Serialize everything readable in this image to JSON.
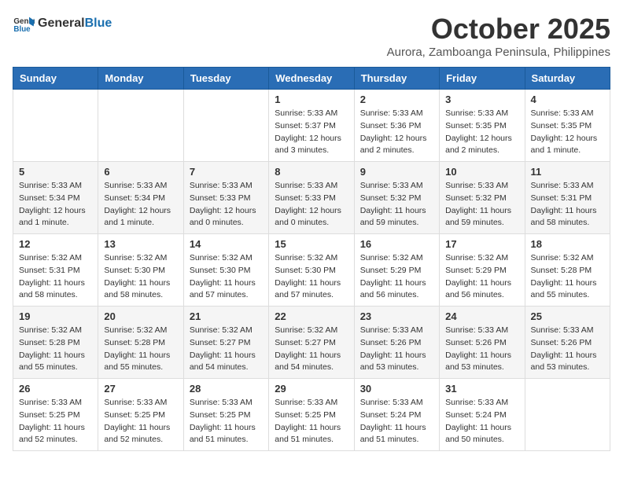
{
  "logo": {
    "general": "General",
    "blue": "Blue"
  },
  "header": {
    "month": "October 2025",
    "location": "Aurora, Zamboanga Peninsula, Philippines"
  },
  "weekdays": [
    "Sunday",
    "Monday",
    "Tuesday",
    "Wednesday",
    "Thursday",
    "Friday",
    "Saturday"
  ],
  "weeks": [
    [
      {
        "day": "",
        "info": ""
      },
      {
        "day": "",
        "info": ""
      },
      {
        "day": "",
        "info": ""
      },
      {
        "day": "1",
        "info": "Sunrise: 5:33 AM\nSunset: 5:37 PM\nDaylight: 12 hours and 3 minutes."
      },
      {
        "day": "2",
        "info": "Sunrise: 5:33 AM\nSunset: 5:36 PM\nDaylight: 12 hours and 2 minutes."
      },
      {
        "day": "3",
        "info": "Sunrise: 5:33 AM\nSunset: 5:35 PM\nDaylight: 12 hours and 2 minutes."
      },
      {
        "day": "4",
        "info": "Sunrise: 5:33 AM\nSunset: 5:35 PM\nDaylight: 12 hours and 1 minute."
      }
    ],
    [
      {
        "day": "5",
        "info": "Sunrise: 5:33 AM\nSunset: 5:34 PM\nDaylight: 12 hours and 1 minute."
      },
      {
        "day": "6",
        "info": "Sunrise: 5:33 AM\nSunset: 5:34 PM\nDaylight: 12 hours and 1 minute."
      },
      {
        "day": "7",
        "info": "Sunrise: 5:33 AM\nSunset: 5:33 PM\nDaylight: 12 hours and 0 minutes."
      },
      {
        "day": "8",
        "info": "Sunrise: 5:33 AM\nSunset: 5:33 PM\nDaylight: 12 hours and 0 minutes."
      },
      {
        "day": "9",
        "info": "Sunrise: 5:33 AM\nSunset: 5:32 PM\nDaylight: 11 hours and 59 minutes."
      },
      {
        "day": "10",
        "info": "Sunrise: 5:33 AM\nSunset: 5:32 PM\nDaylight: 11 hours and 59 minutes."
      },
      {
        "day": "11",
        "info": "Sunrise: 5:33 AM\nSunset: 5:31 PM\nDaylight: 11 hours and 58 minutes."
      }
    ],
    [
      {
        "day": "12",
        "info": "Sunrise: 5:32 AM\nSunset: 5:31 PM\nDaylight: 11 hours and 58 minutes."
      },
      {
        "day": "13",
        "info": "Sunrise: 5:32 AM\nSunset: 5:30 PM\nDaylight: 11 hours and 58 minutes."
      },
      {
        "day": "14",
        "info": "Sunrise: 5:32 AM\nSunset: 5:30 PM\nDaylight: 11 hours and 57 minutes."
      },
      {
        "day": "15",
        "info": "Sunrise: 5:32 AM\nSunset: 5:30 PM\nDaylight: 11 hours and 57 minutes."
      },
      {
        "day": "16",
        "info": "Sunrise: 5:32 AM\nSunset: 5:29 PM\nDaylight: 11 hours and 56 minutes."
      },
      {
        "day": "17",
        "info": "Sunrise: 5:32 AM\nSunset: 5:29 PM\nDaylight: 11 hours and 56 minutes."
      },
      {
        "day": "18",
        "info": "Sunrise: 5:32 AM\nSunset: 5:28 PM\nDaylight: 11 hours and 55 minutes."
      }
    ],
    [
      {
        "day": "19",
        "info": "Sunrise: 5:32 AM\nSunset: 5:28 PM\nDaylight: 11 hours and 55 minutes."
      },
      {
        "day": "20",
        "info": "Sunrise: 5:32 AM\nSunset: 5:28 PM\nDaylight: 11 hours and 55 minutes."
      },
      {
        "day": "21",
        "info": "Sunrise: 5:32 AM\nSunset: 5:27 PM\nDaylight: 11 hours and 54 minutes."
      },
      {
        "day": "22",
        "info": "Sunrise: 5:32 AM\nSunset: 5:27 PM\nDaylight: 11 hours and 54 minutes."
      },
      {
        "day": "23",
        "info": "Sunrise: 5:33 AM\nSunset: 5:26 PM\nDaylight: 11 hours and 53 minutes."
      },
      {
        "day": "24",
        "info": "Sunrise: 5:33 AM\nSunset: 5:26 PM\nDaylight: 11 hours and 53 minutes."
      },
      {
        "day": "25",
        "info": "Sunrise: 5:33 AM\nSunset: 5:26 PM\nDaylight: 11 hours and 53 minutes."
      }
    ],
    [
      {
        "day": "26",
        "info": "Sunrise: 5:33 AM\nSunset: 5:25 PM\nDaylight: 11 hours and 52 minutes."
      },
      {
        "day": "27",
        "info": "Sunrise: 5:33 AM\nSunset: 5:25 PM\nDaylight: 11 hours and 52 minutes."
      },
      {
        "day": "28",
        "info": "Sunrise: 5:33 AM\nSunset: 5:25 PM\nDaylight: 11 hours and 51 minutes."
      },
      {
        "day": "29",
        "info": "Sunrise: 5:33 AM\nSunset: 5:25 PM\nDaylight: 11 hours and 51 minutes."
      },
      {
        "day": "30",
        "info": "Sunrise: 5:33 AM\nSunset: 5:24 PM\nDaylight: 11 hours and 51 minutes."
      },
      {
        "day": "31",
        "info": "Sunrise: 5:33 AM\nSunset: 5:24 PM\nDaylight: 11 hours and 50 minutes."
      },
      {
        "day": "",
        "info": ""
      }
    ]
  ]
}
